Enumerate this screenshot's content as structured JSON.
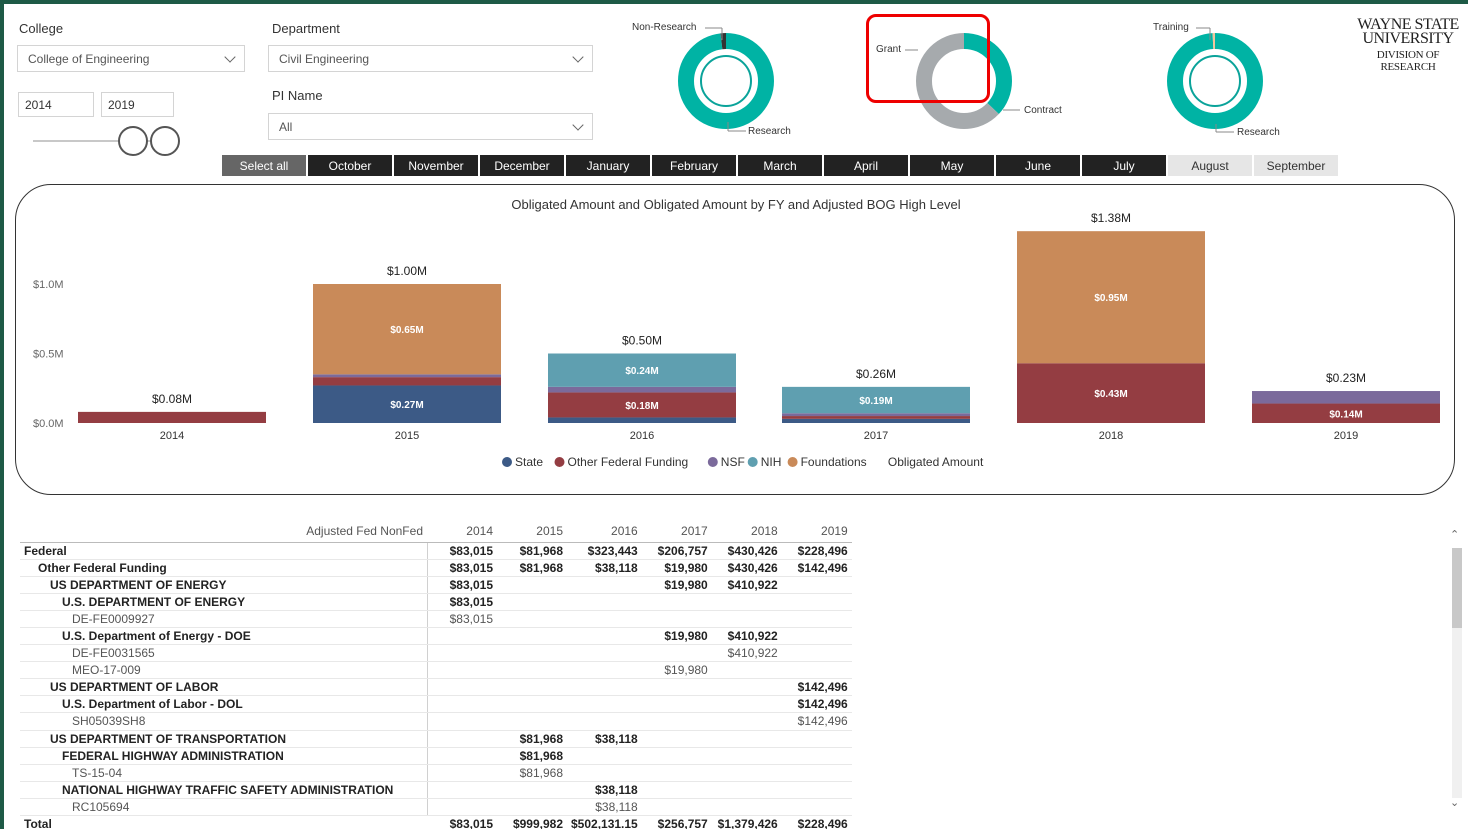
{
  "filters": {
    "college_label": "College",
    "college_value": "College of Engineering",
    "department_label": "Department",
    "department_value": "Civil Engineering",
    "pi_label": "PI Name",
    "pi_value": "All",
    "year_start": "2014",
    "year_end": "2019"
  },
  "months": {
    "select_all": "Select all",
    "items": [
      "October",
      "November",
      "December",
      "January",
      "February",
      "March",
      "April",
      "May",
      "June",
      "July",
      "August",
      "September"
    ]
  },
  "donuts": [
    {
      "top_label": "Non-Research",
      "bottom_label": "Research",
      "fractions": [
        0.98,
        0.02
      ],
      "colors": [
        "#00b3a4",
        "#333333"
      ]
    },
    {
      "top_label": "Grant",
      "bottom_label": "Contract",
      "fractions": [
        0.37,
        0.63
      ],
      "colors": [
        "#00b3a4",
        "#a6aaad"
      ]
    },
    {
      "top_label": "Training",
      "bottom_label": "Research",
      "fractions": [
        0.99,
        0.01
      ],
      "colors": [
        "#00b3a4",
        "#f2c49b"
      ]
    }
  ],
  "logo": {
    "line1": "WAYNE STATE",
    "line2": "UNIVERSITY",
    "line3": "DIVISION OF RESEARCH"
  },
  "colors": {
    "State": "#3c5a86",
    "Other Federal Funding": "#943d42",
    "NSF": "#7b6a9b",
    "NIH": "#5f9fb0",
    "Foundations": "#c98a59",
    "teal": "#00b3a4"
  },
  "chart_data": {
    "type": "bar",
    "stacked": true,
    "title": "Obligated Amount and Obligated Amount by FY and Adjusted BOG High Level",
    "categories": [
      "2014",
      "2015",
      "2016",
      "2017",
      "2018",
      "2019"
    ],
    "series": [
      {
        "name": "State",
        "values": [
          0,
          0.27,
          0.04,
          0.03,
          0,
          0
        ]
      },
      {
        "name": "Other Federal Funding",
        "values": [
          0.08,
          0.06,
          0.18,
          0.02,
          0.43,
          0.14
        ]
      },
      {
        "name": "NSF",
        "values": [
          0,
          0.02,
          0.04,
          0.02,
          0,
          0.09
        ]
      },
      {
        "name": "NIH",
        "values": [
          0,
          0,
          0.24,
          0.19,
          0,
          0
        ]
      },
      {
        "name": "Foundations",
        "values": [
          0,
          0.65,
          0,
          0,
          0.95,
          0
        ]
      }
    ],
    "totals": [
      "$0.08M",
      "$1.00M",
      "$0.50M",
      "$0.26M",
      "$1.38M",
      "$0.23M"
    ],
    "segment_labels": [
      {
        "cat": 1,
        "series": 4,
        "text": "$0.65M"
      },
      {
        "cat": 1,
        "series": 0,
        "text": "$0.27M"
      },
      {
        "cat": 2,
        "series": 3,
        "text": "$0.24M"
      },
      {
        "cat": 2,
        "series": 1,
        "text": "$0.18M"
      },
      {
        "cat": 3,
        "series": 3,
        "text": "$0.19M"
      },
      {
        "cat": 4,
        "series": 4,
        "text": "$0.95M"
      },
      {
        "cat": 4,
        "series": 1,
        "text": "$0.43M"
      },
      {
        "cat": 5,
        "series": 1,
        "text": "$0.14M"
      }
    ],
    "y_ticks": [
      "$0.0M",
      "$0.5M",
      "$1.0M"
    ],
    "y_tick_values": [
      0,
      0.5,
      1.0
    ],
    "ylim": [
      0,
      1.4
    ],
    "legend": [
      "State",
      "Other Federal Funding",
      "NSF",
      "NIH",
      "Foundations",
      "Obligated Amount"
    ],
    "legend_position": "bottom-center"
  },
  "table": {
    "header": [
      "Adjusted Fed NonFed",
      "2014",
      "2015",
      "2016",
      "2017",
      "2018",
      "2019"
    ],
    "rows": [
      {
        "name": "Federal",
        "indent": 0,
        "style": "bold",
        "vals": [
          "$83,015",
          "$81,968",
          "$323,443",
          "$206,757",
          "$430,426",
          "$228,496"
        ]
      },
      {
        "name": "Other Federal Funding",
        "indent": 1,
        "style": "bold",
        "vals": [
          "$83,015",
          "$81,968",
          "$38,118",
          "$19,980",
          "$430,426",
          "$142,496"
        ]
      },
      {
        "name": "US DEPARTMENT OF ENERGY",
        "indent": 2,
        "style": "bold",
        "vals": [
          "$83,015",
          "",
          "",
          "$19,980",
          "$410,922",
          ""
        ]
      },
      {
        "name": "U.S. DEPARTMENT OF ENERGY",
        "indent": 3,
        "style": "bold",
        "vals": [
          "$83,015",
          "",
          "",
          "",
          "",
          ""
        ]
      },
      {
        "name": "DE-FE0009927",
        "indent": 4,
        "style": "plain",
        "vals": [
          "$83,015",
          "",
          "",
          "",
          "",
          ""
        ]
      },
      {
        "name": "U.S. Department of Energy - DOE",
        "indent": 3,
        "style": "bold",
        "vals": [
          "",
          "",
          "",
          "$19,980",
          "$410,922",
          ""
        ]
      },
      {
        "name": "DE-FE0031565",
        "indent": 4,
        "style": "plain",
        "vals": [
          "",
          "",
          "",
          "",
          "$410,922",
          ""
        ]
      },
      {
        "name": "MEO-17-009",
        "indent": 4,
        "style": "plain",
        "vals": [
          "",
          "",
          "",
          "$19,980",
          "",
          ""
        ]
      },
      {
        "name": "US DEPARTMENT OF LABOR",
        "indent": 2,
        "style": "bold",
        "vals": [
          "",
          "",
          "",
          "",
          "",
          "$142,496"
        ]
      },
      {
        "name": "U.S. Department of Labor - DOL",
        "indent": 3,
        "style": "bold",
        "vals": [
          "",
          "",
          "",
          "",
          "",
          "$142,496"
        ]
      },
      {
        "name": "SH05039SH8",
        "indent": 4,
        "style": "plain",
        "vals": [
          "",
          "",
          "",
          "",
          "",
          "$142,496"
        ]
      },
      {
        "name": "US DEPARTMENT OF TRANSPORTATION",
        "indent": 2,
        "style": "bold",
        "vals": [
          "",
          "$81,968",
          "$38,118",
          "",
          "",
          ""
        ]
      },
      {
        "name": "FEDERAL HIGHWAY ADMINISTRATION",
        "indent": 3,
        "style": "bold",
        "vals": [
          "",
          "$81,968",
          "",
          "",
          "",
          ""
        ]
      },
      {
        "name": "TS-15-04",
        "indent": 4,
        "style": "plain",
        "vals": [
          "",
          "$81,968",
          "",
          "",
          "",
          ""
        ]
      },
      {
        "name": "NATIONAL HIGHWAY TRAFFIC SAFETY ADMINISTRATION",
        "indent": 3,
        "style": "bold",
        "vals": [
          "",
          "",
          "$38,118",
          "",
          "",
          ""
        ]
      },
      {
        "name": "RC105694",
        "indent": 4,
        "style": "plain",
        "vals": [
          "",
          "",
          "$38,118",
          "",
          "",
          ""
        ]
      }
    ],
    "total": {
      "name": "Total",
      "vals": [
        "$83,015",
        "$999,982",
        "$502,131.15",
        "$256,757",
        "$1,379,426",
        "$228,496"
      ]
    }
  }
}
